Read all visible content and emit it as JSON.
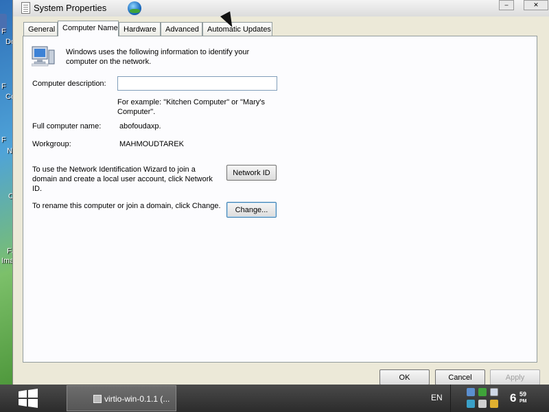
{
  "desktop": {
    "fragments": [
      "F",
      "Do",
      "F",
      "Co",
      "F",
      "N",
      "C",
      "Fa",
      "Ima"
    ]
  },
  "window": {
    "title": "System Properties",
    "controls": {
      "minimize": "–",
      "close": "✕"
    }
  },
  "tabs": [
    {
      "label": "General"
    },
    {
      "label": "Computer Name"
    },
    {
      "label": "Hardware"
    },
    {
      "label": "Advanced"
    },
    {
      "label": "Automatic Updates"
    }
  ],
  "computer_name_tab": {
    "intro": "Windows uses the following information to identify your computer on the network.",
    "description_label": "Computer description:",
    "description_value": "",
    "example_text": "For example: \"Kitchen Computer\" or \"Mary's Computer\".",
    "full_name_label": "Full computer name:",
    "full_name_value": "abofoudaxp.",
    "workgroup_label": "Workgroup:",
    "workgroup_value": "MAHMOUDTAREK",
    "network_id_text": "To use the Network Identification Wizard to join a domain and create a local user account, click Network ID.",
    "network_id_button": "Network ID",
    "rename_text": "To rename this computer or join a domain, click Change.",
    "change_button": "Change..."
  },
  "dialog_buttons": {
    "ok": "OK",
    "cancel": "Cancel",
    "apply": "Apply"
  },
  "taskbar": {
    "task_label": "virtio-win-0.1.1 (...",
    "language": "EN",
    "clock_hour": "6",
    "clock_minute": "59",
    "clock_ampm": "PM"
  }
}
